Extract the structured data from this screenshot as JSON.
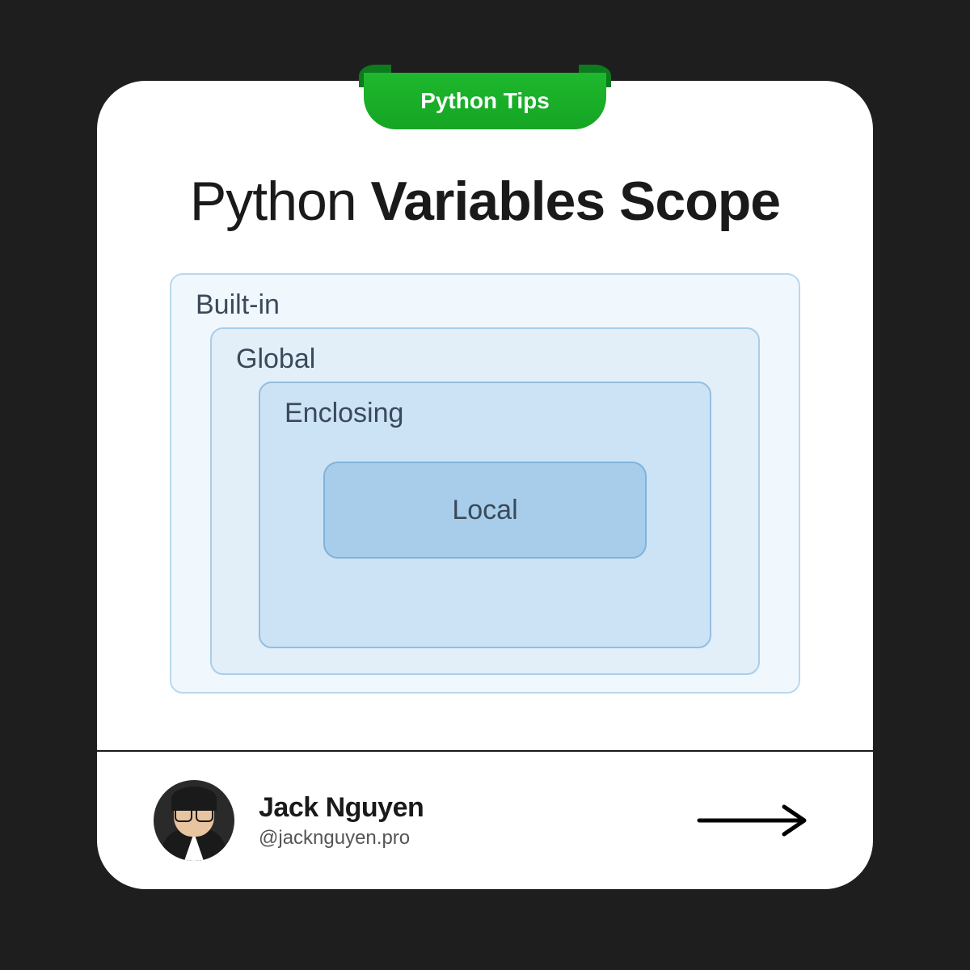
{
  "ribbon": {
    "label": "Python Tips"
  },
  "title": {
    "light": "Python ",
    "bold": "Variables Scope"
  },
  "scopes": {
    "builtin": "Built-in",
    "global": "Global",
    "enclosing": "Enclosing",
    "local": "Local"
  },
  "author": {
    "name": "Jack Nguyen",
    "handle": "@jacknguyen.pro"
  }
}
